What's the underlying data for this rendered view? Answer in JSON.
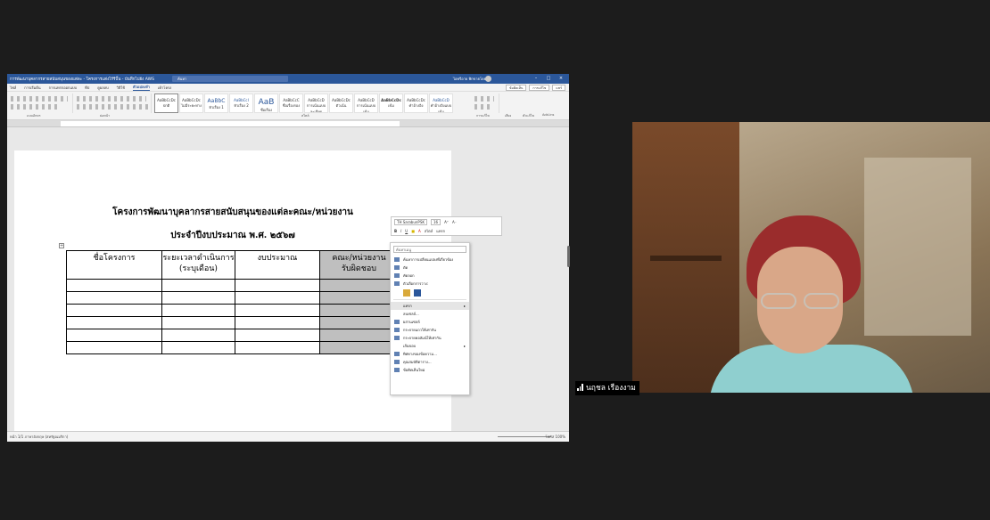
{
  "word": {
    "title": "การพัฒนาบุคลากรสายสนับสนุนของแต่ละ - โครงการแต่งไร้รีบิ้น - บันทึกไปยัง AWS",
    "search_placeholder": "ค้นหา",
    "user": "ไอทรีอาย พิกขายโดยง",
    "menu": [
      "ไฟล์",
      "การเริ่มต้น",
      "การแทรกออกแบบ",
      "ทีป",
      "ดูผลลบ",
      "วิธีใช้",
      "ตัวแปลงจำ",
      "เค้าโครง"
    ],
    "menu_active_index": 6,
    "right_buttons": [
      "ข้อคิดเห็น",
      "การแก้ไข",
      "แชร์"
    ],
    "styles": [
      "AaBbCcDc",
      "AaBbCcDc",
      "AaBbC",
      "AaBbCcI",
      "AaB",
      "AaBbCcC",
      "AaBbCcD",
      "AaBbCcDc",
      "AaBbCcD",
      "AaBbCcDc",
      "AaBbCcDc",
      "AaBbCcD"
    ],
    "style_names": [
      "ปกติ",
      "ไม่มีระยะห่าง",
      "หัวเรื่อง 1",
      "หัวเรื่อง 2",
      "ชื่อเรื่อง",
      "ชื่อเรื่องรอง",
      "การเน้นแบบละเอียด",
      "ตัวเน้น",
      "การเน้นแบบเข้ม",
      "เข้ม",
      "คำอ้างอิง",
      "คำอ้างอิงแบบเข้ม"
    ],
    "ribbon_labels": [
      "แบบอักษร",
      "ย่อหน้า",
      "สไตล์",
      "การแก้ไข",
      "เสียง",
      "ตัวแก้ไข",
      "Add-ins"
    ],
    "status": "หน้า 1/1   ภาษาอังกฤษ (สหรัฐอเมริกา)",
    "status_right": "โฟกัส   100%"
  },
  "document": {
    "title_line1": "โครงการพัฒนาบุคลากรสายสนับสนุนของแต่ละคณะ/หน่วยงาน",
    "title_line2": "ประจำปีงบประมาณ พ.ศ. ๒๕๖๗",
    "table_headers": [
      "ชื่อโครงการ",
      "ระยะเวลาดำเนินการ\n(ระบุเดือน)",
      "งบประมาณ",
      "คณะ/หน่วยงาน\nรับผิดชอบ"
    ],
    "empty_rows": 6
  },
  "mini_toolbar": {
    "font": "TH SarabunPSK",
    "size": "16",
    "buttons": [
      "B",
      "I",
      "U",
      "สไตล์",
      "แทรก"
    ]
  },
  "context_menu": {
    "search": "ค้นหาเมนู",
    "items": [
      {
        "label": "ค้นหาการเปลี่ยนแปลงที่เกี่ยวข้อง",
        "arrow": false
      },
      {
        "label": "ตัด",
        "arrow": false
      },
      {
        "label": "คัดลอก",
        "arrow": false
      },
      {
        "label": "ตัวเลือกการวาง:",
        "arrow": false
      },
      {
        "label": "แทรก",
        "arrow": true
      },
      {
        "label": "ลบเซลล์...",
        "arrow": false
      },
      {
        "label": "ผสานเซลล์",
        "arrow": false
      },
      {
        "label": "กระจายแถวให้เท่ากัน",
        "arrow": false
      },
      {
        "label": "กระจายคอลัมน์ให้เท่ากัน",
        "arrow": false
      },
      {
        "label": "เส้นขอบ",
        "arrow": true
      },
      {
        "label": "ทิศทางของข้อความ...",
        "arrow": false
      },
      {
        "label": "คุณสมบัติตาราง...",
        "arrow": false
      },
      {
        "label": "ข้อคิดเห็นใหม่",
        "arrow": false
      }
    ],
    "highlight_index": 4
  },
  "participant": {
    "name": "นฤชล เรืองงาม"
  }
}
